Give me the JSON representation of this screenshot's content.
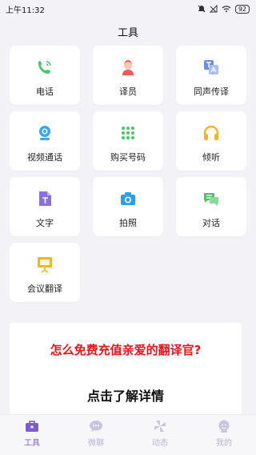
{
  "status": {
    "time": "上午11:32",
    "battery": "92"
  },
  "header": {
    "title": "工具"
  },
  "tools": [
    {
      "label": "电话",
      "icon": "phone-icon"
    },
    {
      "label": "译员",
      "icon": "translator-person-icon"
    },
    {
      "label": "同声传译",
      "icon": "simultaneous-translate-icon"
    },
    {
      "label": "视频通话",
      "icon": "video-call-icon"
    },
    {
      "label": "购买号码",
      "icon": "keypad-icon"
    },
    {
      "label": "倾听",
      "icon": "headphones-icon"
    },
    {
      "label": "文字",
      "icon": "text-icon"
    },
    {
      "label": "拍照",
      "icon": "camera-icon"
    },
    {
      "label": "对话",
      "icon": "chat-bubbles-icon"
    },
    {
      "label": "会议翻译",
      "icon": "meeting-board-icon"
    }
  ],
  "banner": {
    "promo": "怎么免费充值亲爱的翻译官?",
    "detail": "点击了解详情"
  },
  "tabs": [
    {
      "label": "工具",
      "icon": "toolbox-icon",
      "active": true
    },
    {
      "label": "微聊",
      "icon": "chat-icon",
      "active": false
    },
    {
      "label": "动态",
      "icon": "pinwheel-icon",
      "active": false
    },
    {
      "label": "我的",
      "icon": "profile-icon",
      "active": false
    }
  ],
  "colors": {
    "accent": "#7d5bc9",
    "promo": "#e8141a",
    "inactive_tab": "#c9c4da"
  }
}
